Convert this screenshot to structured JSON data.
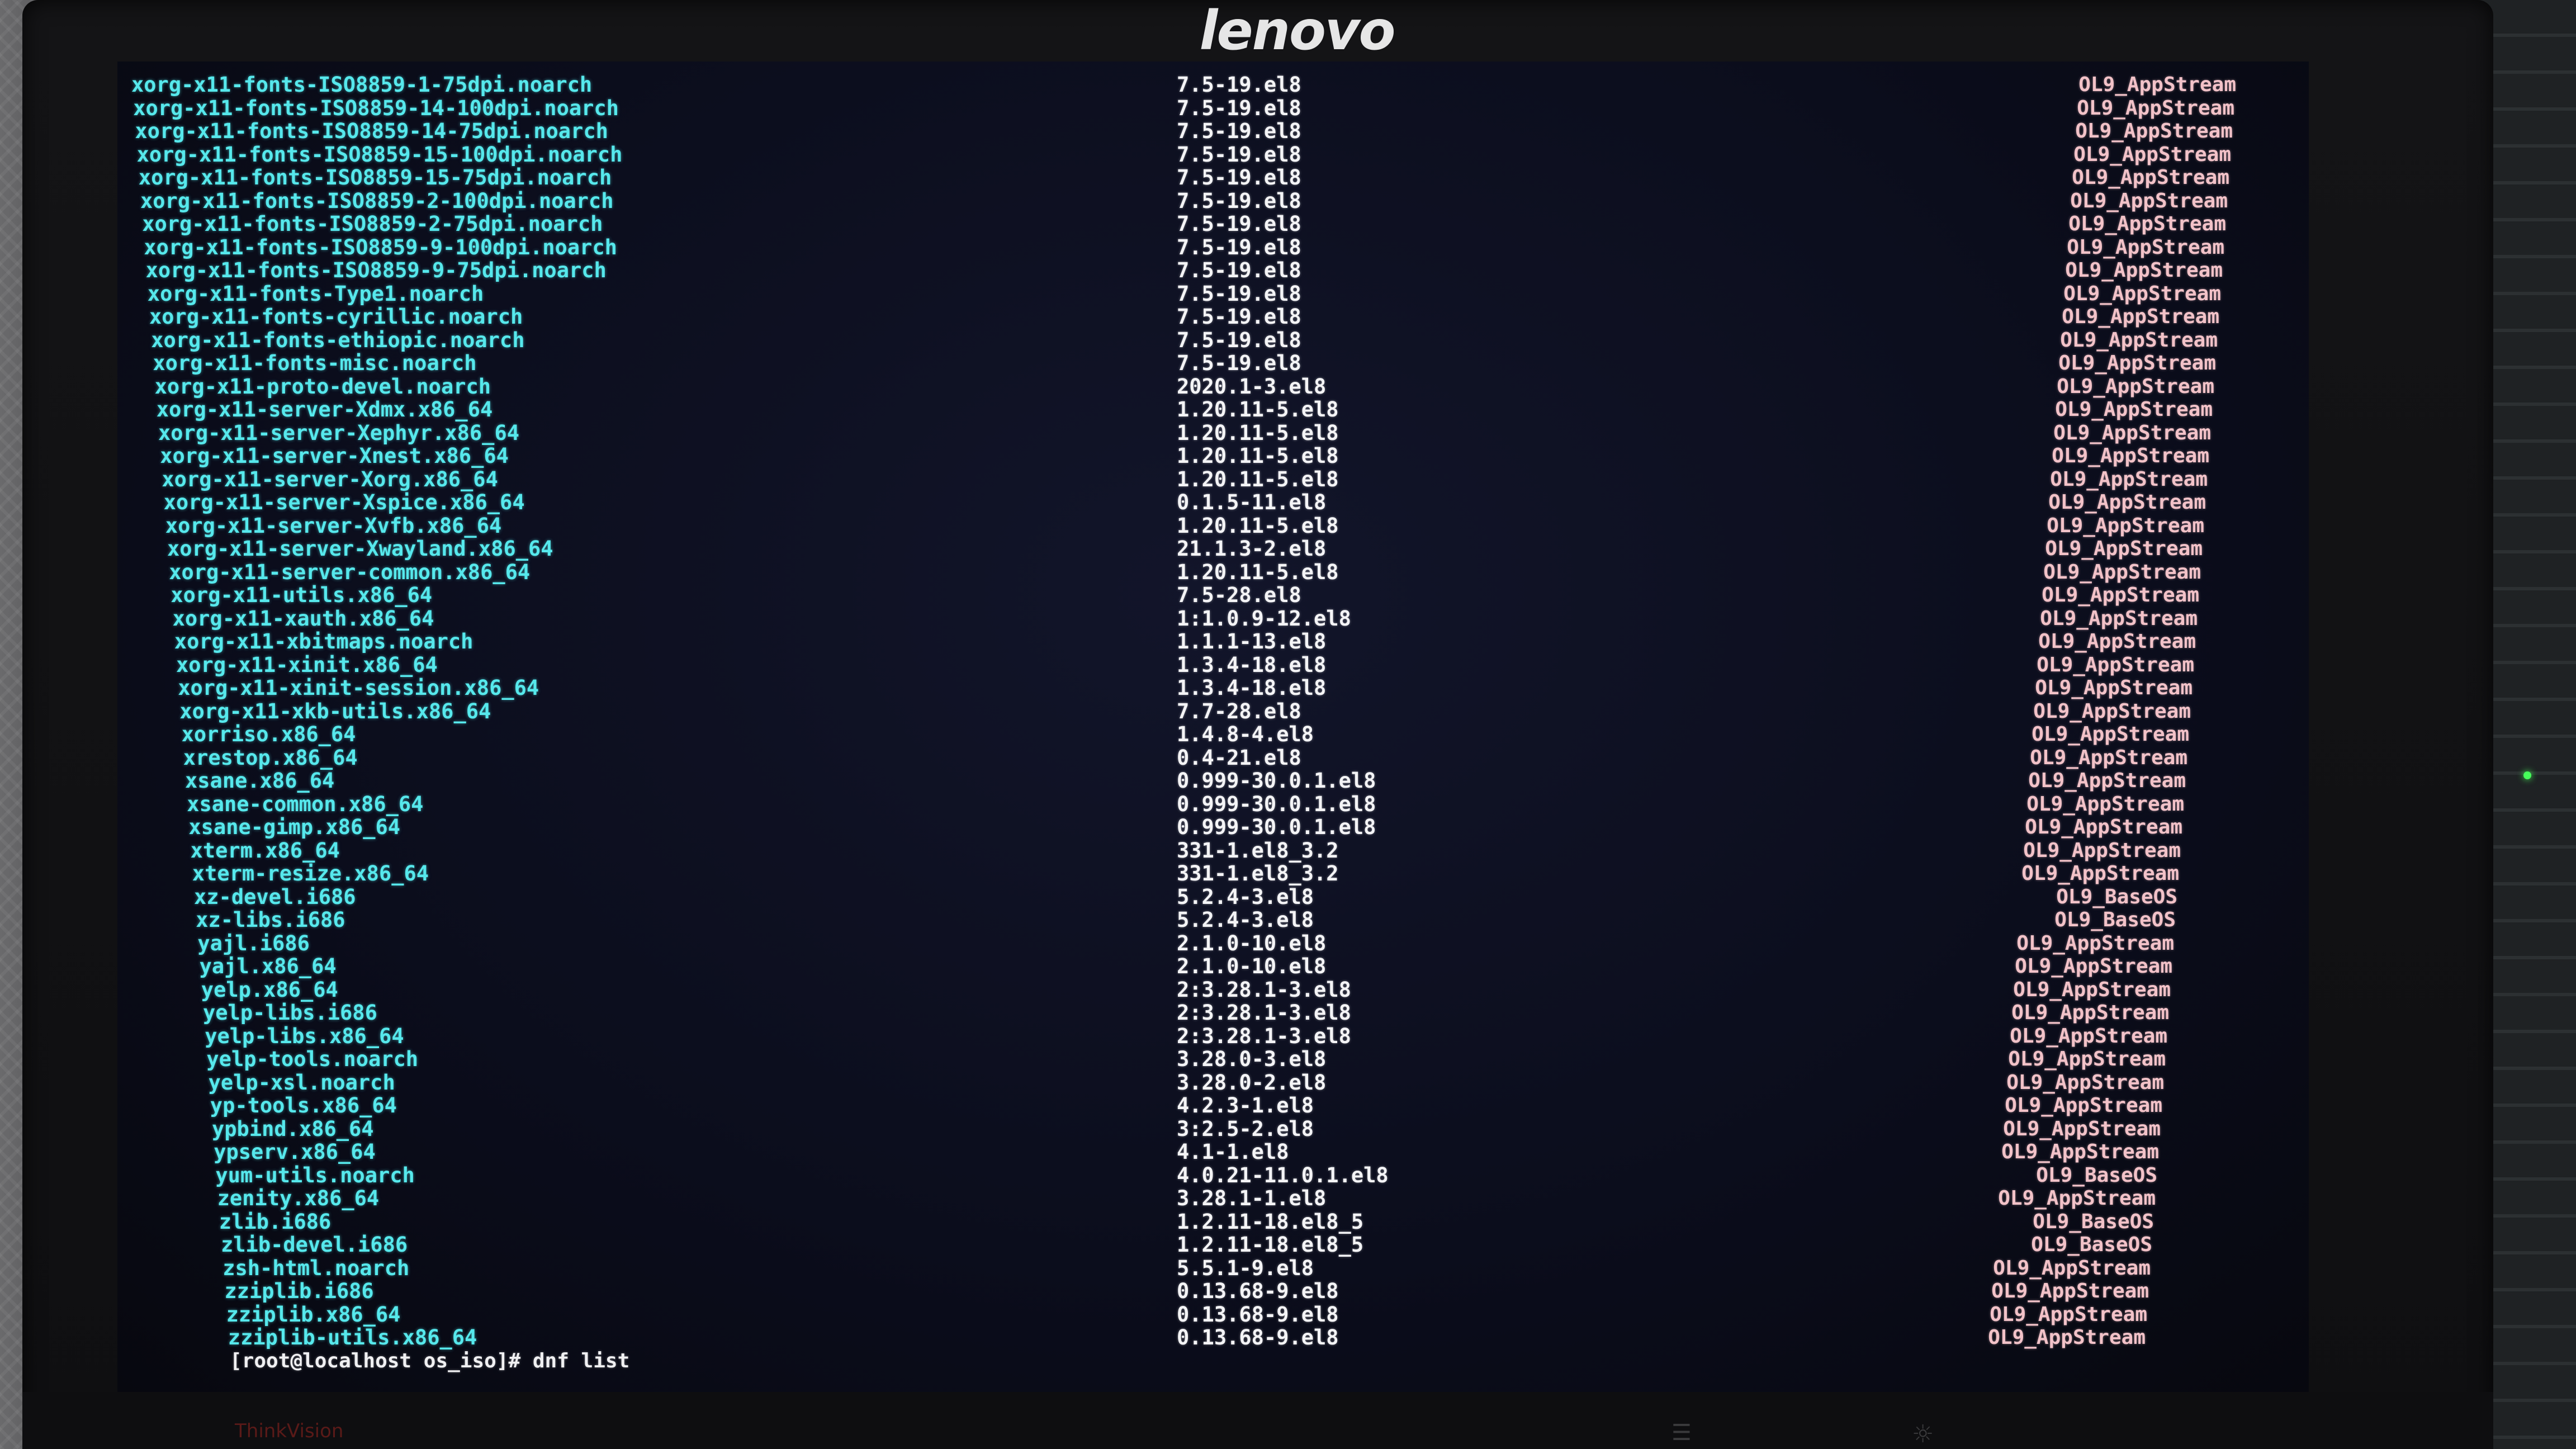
{
  "monitor": {
    "brand": "lenovo",
    "bottom_label": "ThinkVision",
    "menu_icon": "menu-icon",
    "power_icon": "gear-icon"
  },
  "terminal": {
    "rows": [
      {
        "pkg": "xorg-x11-fonts-ISO8859-1-75dpi.noarch",
        "ver": "7.5-19.el8",
        "repo": "OL9_AppStream"
      },
      {
        "pkg": "xorg-x11-fonts-ISO8859-14-100dpi.noarch",
        "ver": "7.5-19.el8",
        "repo": "OL9_AppStream"
      },
      {
        "pkg": "xorg-x11-fonts-ISO8859-14-75dpi.noarch",
        "ver": "7.5-19.el8",
        "repo": "OL9_AppStream"
      },
      {
        "pkg": "xorg-x11-fonts-ISO8859-15-100dpi.noarch",
        "ver": "7.5-19.el8",
        "repo": "OL9_AppStream"
      },
      {
        "pkg": "xorg-x11-fonts-ISO8859-15-75dpi.noarch",
        "ver": "7.5-19.el8",
        "repo": "OL9_AppStream"
      },
      {
        "pkg": "xorg-x11-fonts-ISO8859-2-100dpi.noarch",
        "ver": "7.5-19.el8",
        "repo": "OL9_AppStream"
      },
      {
        "pkg": "xorg-x11-fonts-ISO8859-2-75dpi.noarch",
        "ver": "7.5-19.el8",
        "repo": "OL9_AppStream"
      },
      {
        "pkg": "xorg-x11-fonts-ISO8859-9-100dpi.noarch",
        "ver": "7.5-19.el8",
        "repo": "OL9_AppStream"
      },
      {
        "pkg": "xorg-x11-fonts-ISO8859-9-75dpi.noarch",
        "ver": "7.5-19.el8",
        "repo": "OL9_AppStream"
      },
      {
        "pkg": "xorg-x11-fonts-Type1.noarch",
        "ver": "7.5-19.el8",
        "repo": "OL9_AppStream"
      },
      {
        "pkg": "xorg-x11-fonts-cyrillic.noarch",
        "ver": "7.5-19.el8",
        "repo": "OL9_AppStream"
      },
      {
        "pkg": "xorg-x11-fonts-ethiopic.noarch",
        "ver": "7.5-19.el8",
        "repo": "OL9_AppStream"
      },
      {
        "pkg": "xorg-x11-fonts-misc.noarch",
        "ver": "7.5-19.el8",
        "repo": "OL9_AppStream"
      },
      {
        "pkg": "xorg-x11-proto-devel.noarch",
        "ver": "2020.1-3.el8",
        "repo": "OL9_AppStream"
      },
      {
        "pkg": "xorg-x11-server-Xdmx.x86_64",
        "ver": "1.20.11-5.el8",
        "repo": "OL9_AppStream"
      },
      {
        "pkg": "xorg-x11-server-Xephyr.x86_64",
        "ver": "1.20.11-5.el8",
        "repo": "OL9_AppStream"
      },
      {
        "pkg": "xorg-x11-server-Xnest.x86_64",
        "ver": "1.20.11-5.el8",
        "repo": "OL9_AppStream"
      },
      {
        "pkg": "xorg-x11-server-Xorg.x86_64",
        "ver": "1.20.11-5.el8",
        "repo": "OL9_AppStream"
      },
      {
        "pkg": "xorg-x11-server-Xspice.x86_64",
        "ver": "0.1.5-11.el8",
        "repo": "OL9_AppStream"
      },
      {
        "pkg": "xorg-x11-server-Xvfb.x86_64",
        "ver": "1.20.11-5.el8",
        "repo": "OL9_AppStream"
      },
      {
        "pkg": "xorg-x11-server-Xwayland.x86_64",
        "ver": "21.1.3-2.el8",
        "repo": "OL9_AppStream"
      },
      {
        "pkg": "xorg-x11-server-common.x86_64",
        "ver": "1.20.11-5.el8",
        "repo": "OL9_AppStream"
      },
      {
        "pkg": "xorg-x11-utils.x86_64",
        "ver": "7.5-28.el8",
        "repo": "OL9_AppStream"
      },
      {
        "pkg": "xorg-x11-xauth.x86_64",
        "ver": "1:1.0.9-12.el8",
        "repo": "OL9_AppStream"
      },
      {
        "pkg": "xorg-x11-xbitmaps.noarch",
        "ver": "1.1.1-13.el8",
        "repo": "OL9_AppStream"
      },
      {
        "pkg": "xorg-x11-xinit.x86_64",
        "ver": "1.3.4-18.el8",
        "repo": "OL9_AppStream"
      },
      {
        "pkg": "xorg-x11-xinit-session.x86_64",
        "ver": "1.3.4-18.el8",
        "repo": "OL9_AppStream"
      },
      {
        "pkg": "xorg-x11-xkb-utils.x86_64",
        "ver": "7.7-28.el8",
        "repo": "OL9_AppStream"
      },
      {
        "pkg": "xorriso.x86_64",
        "ver": "1.4.8-4.el8",
        "repo": "OL9_AppStream"
      },
      {
        "pkg": "xrestop.x86_64",
        "ver": "0.4-21.el8",
        "repo": "OL9_AppStream"
      },
      {
        "pkg": "xsane.x86_64",
        "ver": "0.999-30.0.1.el8",
        "repo": "OL9_AppStream"
      },
      {
        "pkg": "xsane-common.x86_64",
        "ver": "0.999-30.0.1.el8",
        "repo": "OL9_AppStream"
      },
      {
        "pkg": "xsane-gimp.x86_64",
        "ver": "0.999-30.0.1.el8",
        "repo": "OL9_AppStream"
      },
      {
        "pkg": "xterm.x86_64",
        "ver": "331-1.el8_3.2",
        "repo": "OL9_AppStream"
      },
      {
        "pkg": "xterm-resize.x86_64",
        "ver": "331-1.el8_3.2",
        "repo": "OL9_AppStream"
      },
      {
        "pkg": "xz-devel.i686",
        "ver": "5.2.4-3.el8",
        "repo": "OL9_BaseOS"
      },
      {
        "pkg": "xz-libs.i686",
        "ver": "5.2.4-3.el8",
        "repo": "OL9_BaseOS"
      },
      {
        "pkg": "yajl.i686",
        "ver": "2.1.0-10.el8",
        "repo": "OL9_AppStream"
      },
      {
        "pkg": "yajl.x86_64",
        "ver": "2.1.0-10.el8",
        "repo": "OL9_AppStream"
      },
      {
        "pkg": "yelp.x86_64",
        "ver": "2:3.28.1-3.el8",
        "repo": "OL9_AppStream"
      },
      {
        "pkg": "yelp-libs.i686",
        "ver": "2:3.28.1-3.el8",
        "repo": "OL9_AppStream"
      },
      {
        "pkg": "yelp-libs.x86_64",
        "ver": "2:3.28.1-3.el8",
        "repo": "OL9_AppStream"
      },
      {
        "pkg": "yelp-tools.noarch",
        "ver": "3.28.0-3.el8",
        "repo": "OL9_AppStream"
      },
      {
        "pkg": "yelp-xsl.noarch",
        "ver": "3.28.0-2.el8",
        "repo": "OL9_AppStream"
      },
      {
        "pkg": "yp-tools.x86_64",
        "ver": "4.2.3-1.el8",
        "repo": "OL9_AppStream"
      },
      {
        "pkg": "ypbind.x86_64",
        "ver": "3:2.5-2.el8",
        "repo": "OL9_AppStream"
      },
      {
        "pkg": "ypserv.x86_64",
        "ver": "4.1-1.el8",
        "repo": "OL9_AppStream"
      },
      {
        "pkg": "yum-utils.noarch",
        "ver": "4.0.21-11.0.1.el8",
        "repo": "OL9_BaseOS"
      },
      {
        "pkg": "zenity.x86_64",
        "ver": "3.28.1-1.el8",
        "repo": "OL9_AppStream"
      },
      {
        "pkg": "zlib.i686",
        "ver": "1.2.11-18.el8_5",
        "repo": "OL9_BaseOS"
      },
      {
        "pkg": "zlib-devel.i686",
        "ver": "1.2.11-18.el8_5",
        "repo": "OL9_BaseOS"
      },
      {
        "pkg": "zsh-html.noarch",
        "ver": "5.5.1-9.el8",
        "repo": "OL9_AppStream"
      },
      {
        "pkg": "zziplib.i686",
        "ver": "0.13.68-9.el8",
        "repo": "OL9_AppStream"
      },
      {
        "pkg": "zziplib.x86_64",
        "ver": "0.13.68-9.el8",
        "repo": "OL9_AppStream"
      },
      {
        "pkg": "zziplib-utils.x86_64",
        "ver": "0.13.68-9.el8",
        "repo": "OL9_AppStream"
      }
    ],
    "prompt": "[root@localhost os_iso]# dnf list"
  },
  "colors": {
    "package_name": "#56e8ec",
    "version": "#f4f4f6",
    "repo": "#f2c2c8",
    "screen_bg": "#0b0d1c"
  }
}
